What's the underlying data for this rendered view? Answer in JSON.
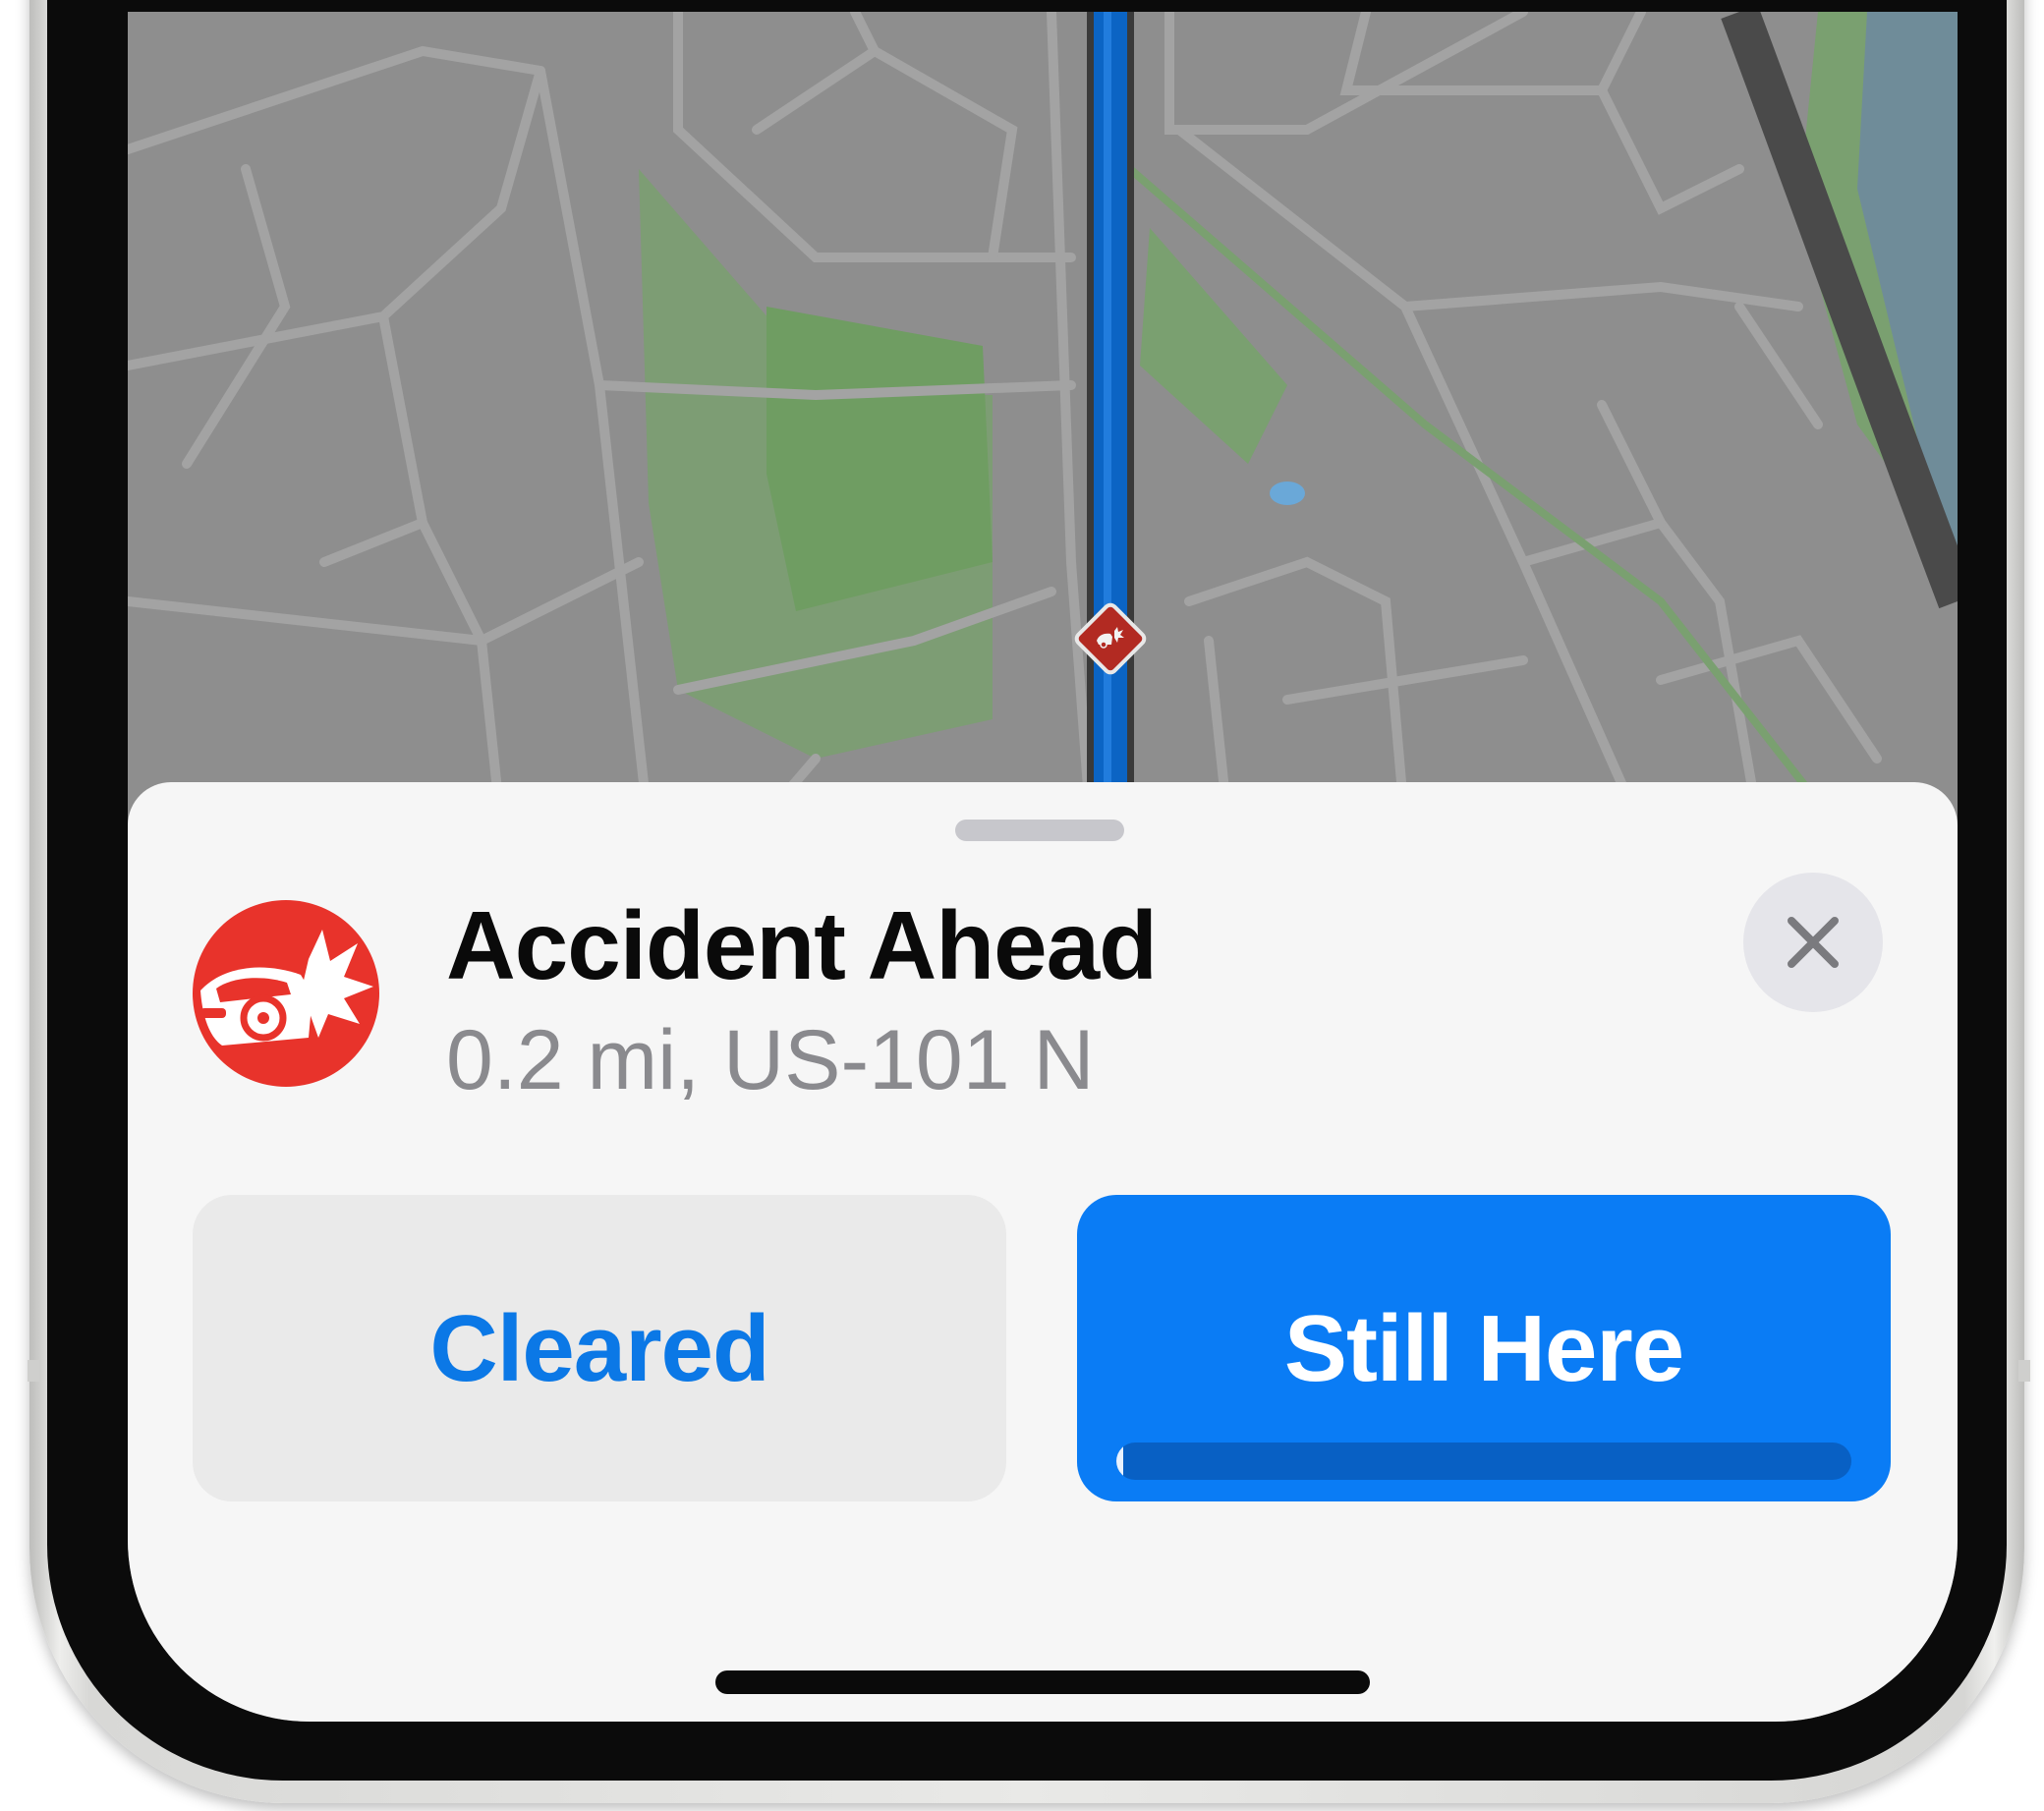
{
  "map": {
    "route_color": "#0b64c4",
    "park_color": "#7fa77a",
    "water_color": "#6f8c99",
    "incident_marker_icon": "car-crash-icon"
  },
  "alert": {
    "icon": "car-crash-icon",
    "icon_color": "#e8332b",
    "title": "Accident Ahead",
    "subtitle": "0.2 mi, US-101 N",
    "close_icon": "close-icon"
  },
  "actions": {
    "cleared_label": "Cleared",
    "still_here_label": "Still Here",
    "countdown_progress": 0.01,
    "primary_color": "#0a7cf5",
    "secondary_text_color": "#0b78e6"
  }
}
